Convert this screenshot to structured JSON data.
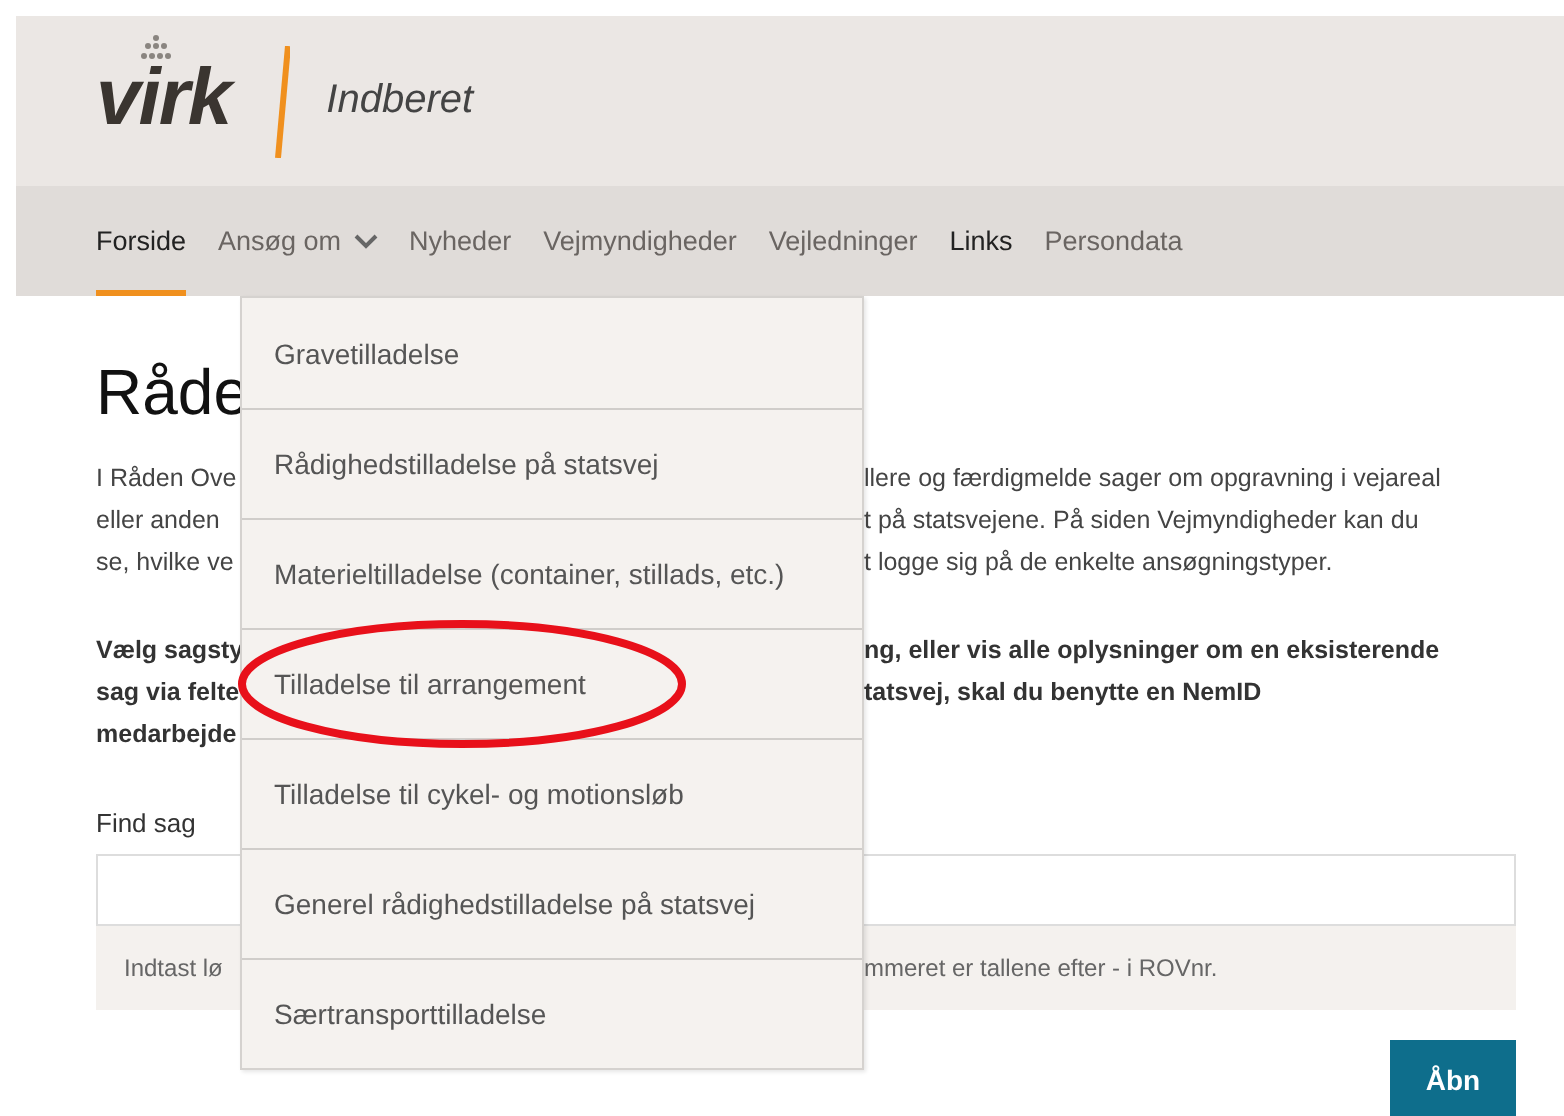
{
  "header": {
    "logo": "virk",
    "app_name": "Indberet"
  },
  "nav": [
    {
      "label": "Forside",
      "selected": true,
      "has_menu": false,
      "bold": false
    },
    {
      "label": "Ansøg om",
      "selected": false,
      "has_menu": true,
      "bold": false
    },
    {
      "label": "Nyheder",
      "selected": false,
      "has_menu": false,
      "bold": false
    },
    {
      "label": "Vejmyndigheder",
      "selected": false,
      "has_menu": false,
      "bold": false
    },
    {
      "label": "Vejledninger",
      "selected": false,
      "has_menu": false,
      "bold": false
    },
    {
      "label": "Links",
      "selected": false,
      "has_menu": false,
      "bold": true
    },
    {
      "label": "Persondata",
      "selected": false,
      "has_menu": false,
      "bold": false
    }
  ],
  "dropdown": [
    {
      "label": "Gravetilladelse",
      "circled": false
    },
    {
      "label": "Rådighedstilladelse på statsvej",
      "circled": false
    },
    {
      "label": "Materieltilladelse (container, stillads, etc.)",
      "circled": false
    },
    {
      "label": "Tilladelse til arrangement",
      "circled": true
    },
    {
      "label": "Tilladelse til cykel- og motionsløb",
      "circled": false
    },
    {
      "label": "Generel rådighedstilladelse på statsvej",
      "circled": false
    },
    {
      "label": "Særtransporttilladelse",
      "circled": false
    }
  ],
  "heading": "Råde",
  "intro_lines": [
    {
      "left": "I Råden Ove",
      "right": "llere og færdigmelde sager om opgravning i vejareal"
    },
    {
      "left": "eller anden",
      "right": "t på statsvejene. På siden Vejmyndigheder kan du"
    },
    {
      "left": "se, hvilke ve",
      "right": "t logge sig på de enkelte ansøgningstyper."
    }
  ],
  "bold_lines": [
    {
      "left": "Vælg sagsty",
      "right": "ng, eller vis alle oplysninger om en eksisterende"
    },
    {
      "left": "sag via felte",
      "right": "tatsvej, skal du benytte en NemID"
    },
    {
      "left": "medarbejde"
    }
  ],
  "find": {
    "label": "Find sag",
    "hint_left": "Indtast lø",
    "hint_right": "mmeret er tallene efter - i ROVnr."
  },
  "open_button": "Åbn"
}
